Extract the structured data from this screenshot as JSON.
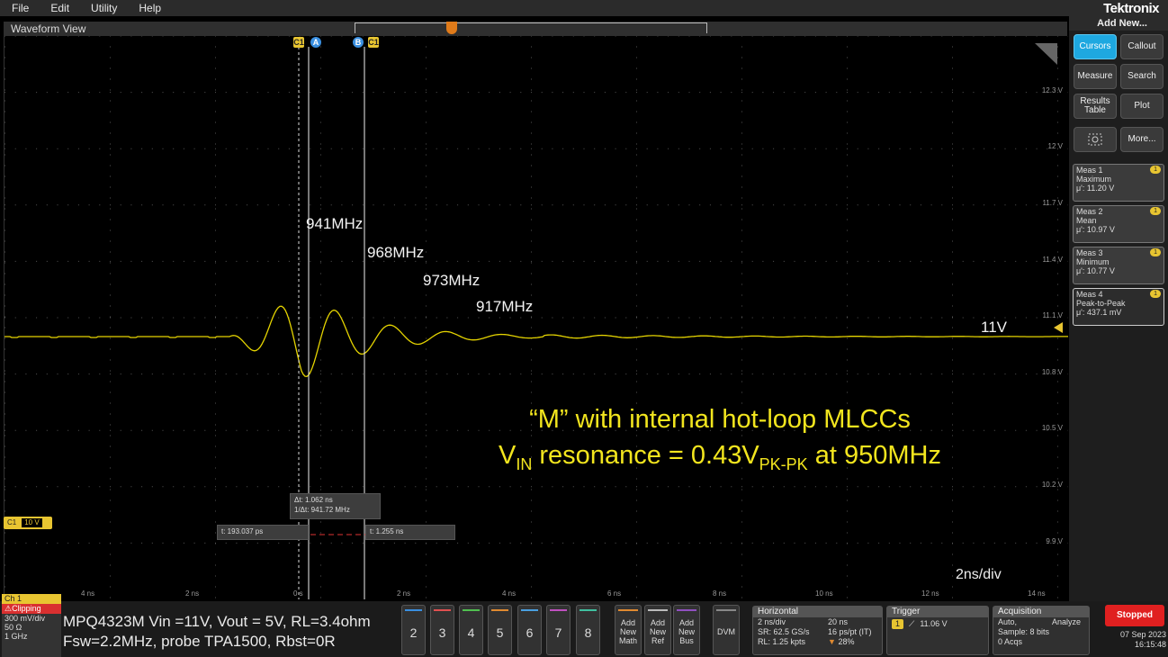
{
  "menu": [
    "File",
    "Edit",
    "Utility",
    "Help"
  ],
  "brand": {
    "logo": "Tektronix",
    "add_new": "Add New..."
  },
  "waveform_view": {
    "title": "Waveform View",
    "cursor_tags": {
      "c1_left": "C1",
      "a": "A",
      "b": "B",
      "c1_right": "C1"
    },
    "annotations": [
      "941MHz",
      "968MHz",
      "973MHz",
      "917MHz"
    ],
    "level_label": "11V",
    "timebase_label": "2ns/div",
    "hotloop_line1": "“M” with internal hot-loop MLCCs",
    "hotloop_line2_pre": "V",
    "hotloop_line2_sub1": "IN",
    "hotloop_line2_mid": " resonance = 0.43V",
    "hotloop_line2_sub2": "PK-PK",
    "hotloop_line2_post": " at 950MHz",
    "volt_ticks": [
      "12.3 V",
      "12 V",
      "11.7 V",
      "11.4 V",
      "11.1 V",
      "10.8 V",
      "10.5 V",
      "10.2 V",
      "9.9 V"
    ],
    "time_ticks": [
      "4 ns",
      "2 ns",
      "0 s",
      "2 ns",
      "4 ns",
      "6 ns",
      "8 ns",
      "10 ns",
      "12 ns",
      "14 ns"
    ],
    "cursor_readout": {
      "delta_t": "Δt: 1.062 ns",
      "inv_delta_t": "1/Δt: 941.72 MHz",
      "t_a": "t: 193.037 ps",
      "t_b": "t: 1.255 ns"
    },
    "ch1_badge": {
      "label": "C1",
      "scale": "10 V"
    },
    "colors": {
      "ch1": "#e8c531",
      "waveform": "#e5d400"
    }
  },
  "right_panel": {
    "buttons": [
      {
        "label": "Cursors",
        "active": true
      },
      {
        "label": "Callout",
        "active": false
      },
      {
        "label": "Measure",
        "active": false
      },
      {
        "label": "Search",
        "active": false
      },
      {
        "label": "Results Table",
        "active": false
      },
      {
        "label": "Plot",
        "active": false
      },
      {
        "label": "More...",
        "active": false
      }
    ],
    "measurements": [
      {
        "title": "Meas 1",
        "type": "Maximum",
        "value": "μ': 11.20 V",
        "badge": "1"
      },
      {
        "title": "Meas 2",
        "type": "Mean",
        "value": "μ': 10.97 V",
        "badge": "1"
      },
      {
        "title": "Meas 3",
        "type": "Minimum",
        "value": "μ': 10.77 V",
        "badge": "1"
      },
      {
        "title": "Meas 4",
        "type": "Peak-to-Peak",
        "value": "μ': 437.1 mV",
        "badge": "1"
      }
    ]
  },
  "bottom": {
    "ch1": {
      "name": "Ch 1",
      "status": "Clipping",
      "scale": "300 mV/div",
      "impedance": "50 Ω",
      "bandwidth": "1 GHz"
    },
    "caption_line1": "MPQ4323M Vin =11V, Vout = 5V, RL=3.4ohm",
    "caption_line2": "Fsw=2.2MHz, probe TPA1500, Rbst=0R",
    "channels": [
      {
        "label": "2",
        "color": "#3a8fe0"
      },
      {
        "label": "3",
        "color": "#e05050"
      },
      {
        "label": "4",
        "color": "#50c050"
      },
      {
        "label": "5",
        "color": "#e08a30"
      },
      {
        "label": "6",
        "color": "#4aa0e0"
      },
      {
        "label": "7",
        "color": "#c050c0"
      },
      {
        "label": "8",
        "color": "#40c0a0"
      }
    ],
    "add": [
      {
        "l1": "Add",
        "l2": "New",
        "l3": "Math"
      },
      {
        "l1": "Add",
        "l2": "New",
        "l3": "Ref"
      },
      {
        "l1": "Add",
        "l2": "New",
        "l3": "Bus"
      }
    ],
    "dvm": "DVM",
    "horizontal": {
      "title": "Horizontal",
      "scale": "2 ns/div",
      "duration": "20 ns",
      "sr": "SR: 62.5 GS/s",
      "pts": "16 ps/pt (IT)",
      "rl": "RL: 1.25 kpts",
      "pct": "28%"
    },
    "trigger": {
      "title": "Trigger",
      "src": "1",
      "level": "11.06 V"
    },
    "acquisition": {
      "title": "Acquisition",
      "mode": "Auto,",
      "analyze": "Analyze",
      "sample": "Sample: 8 bits",
      "acqs": "0 Acqs"
    },
    "run_state": "Stopped",
    "date": "07 Sep 2023",
    "time": "16:15:48"
  }
}
